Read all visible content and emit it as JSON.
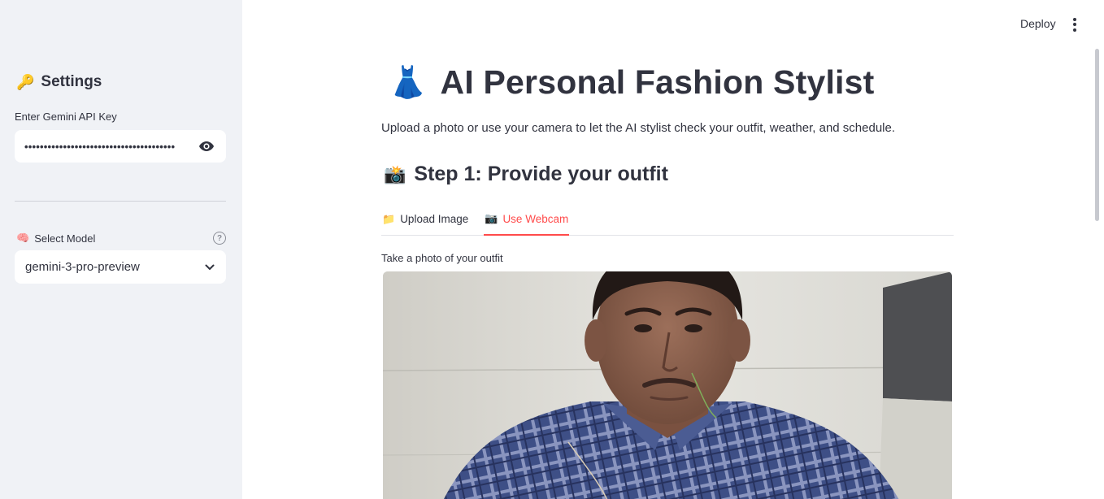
{
  "sidebar": {
    "settings_icon": "key-emoji",
    "settings_emoji": "🔑",
    "settings_title": "Settings",
    "api_key_label": "Enter Gemini API Key",
    "api_key_value": "•••••••••••••••••••••••••••••••••••••••",
    "model_emoji": "🧠",
    "model_label": "Select Model",
    "model_selected": "gemini-3-pro-preview"
  },
  "header": {
    "deploy_label": "Deploy"
  },
  "main": {
    "title_emoji": "👗",
    "title": "AI Personal Fashion Stylist",
    "intro": "Upload a photo or use your camera to let the AI stylist check your outfit, weather, and schedule.",
    "step1_emoji": "📸",
    "step1_title": "Step 1: Provide your outfit",
    "tabs": [
      {
        "emoji": "📁",
        "label": "Upload Image",
        "active": false
      },
      {
        "emoji": "📷",
        "label": "Use Webcam",
        "active": true
      }
    ],
    "camera_label": "Take a photo of your outfit"
  },
  "colors": {
    "accent": "#ff4b4b",
    "sidebar_bg": "#f0f2f6",
    "text": "#31333f"
  }
}
